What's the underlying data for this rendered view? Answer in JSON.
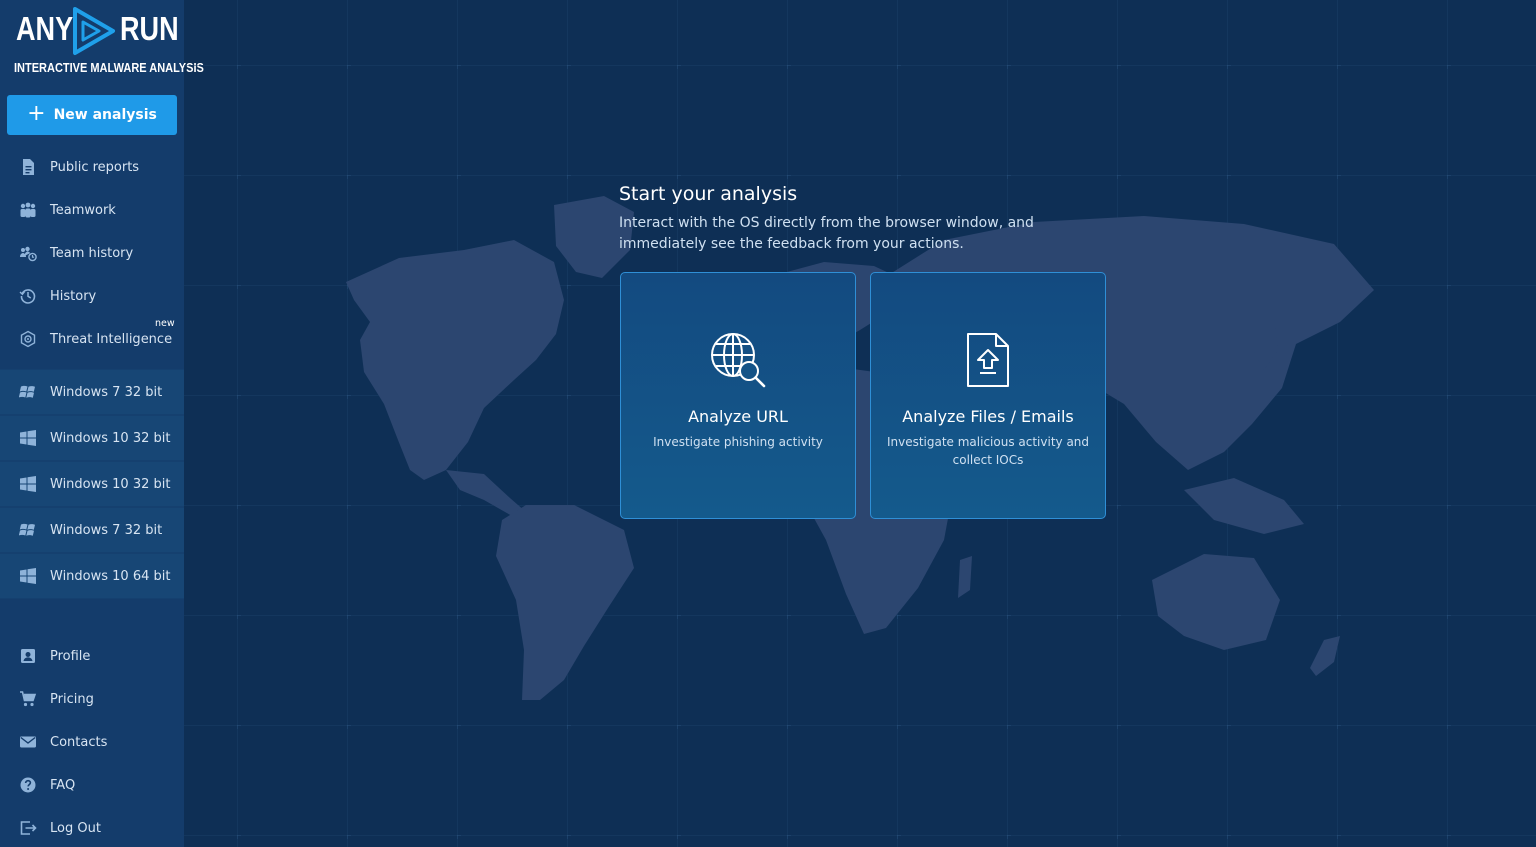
{
  "brand": {
    "word_left": "ANY",
    "word_right": "RUN",
    "tagline": "INTERACTIVE MALWARE ANALYSIS"
  },
  "sidebar": {
    "new_analysis_label": "New analysis",
    "nav_top": [
      {
        "label": "Public reports",
        "icon": "document-icon"
      },
      {
        "label": "Teamwork",
        "icon": "team-icon"
      },
      {
        "label": "Team history",
        "icon": "team-history-icon"
      },
      {
        "label": "History",
        "icon": "history-icon"
      },
      {
        "label": "Threat Intelligence",
        "icon": "threat-intel-icon",
        "badge": "new"
      }
    ],
    "os_items": [
      {
        "label": "Windows 7 32 bit",
        "icon": "windows7-icon"
      },
      {
        "label": "Windows 10 32 bit",
        "icon": "windows10-icon"
      },
      {
        "label": "Windows 10 32 bit",
        "icon": "windows10-icon"
      },
      {
        "label": "Windows 7 32 bit",
        "icon": "windows7-icon"
      },
      {
        "label": "Windows 10 64 bit",
        "icon": "windows10-icon"
      }
    ],
    "nav_bottom": [
      {
        "label": "Profile",
        "icon": "profile-icon"
      },
      {
        "label": "Pricing",
        "icon": "cart-icon"
      },
      {
        "label": "Contacts",
        "icon": "mail-icon"
      },
      {
        "label": "FAQ",
        "icon": "question-icon"
      },
      {
        "label": "Log Out",
        "icon": "logout-icon"
      }
    ]
  },
  "main": {
    "heading": "Start your analysis",
    "subtext": "Interact with the OS directly from the browser window, and immediately see the feedback from your actions.",
    "cards": [
      {
        "title": "Analyze URL",
        "desc": "Investigate phishing activity",
        "icon": "globe-search-icon"
      },
      {
        "title": "Analyze Files / Emails",
        "desc": "Investigate malicious activity and collect IOCs",
        "icon": "file-upload-icon"
      }
    ]
  },
  "colors": {
    "background": "#0e2f55",
    "sidebar": "#143c6b",
    "accent": "#1f9ae8",
    "card_border": "#2f8fd6",
    "map": "#2c4670"
  }
}
